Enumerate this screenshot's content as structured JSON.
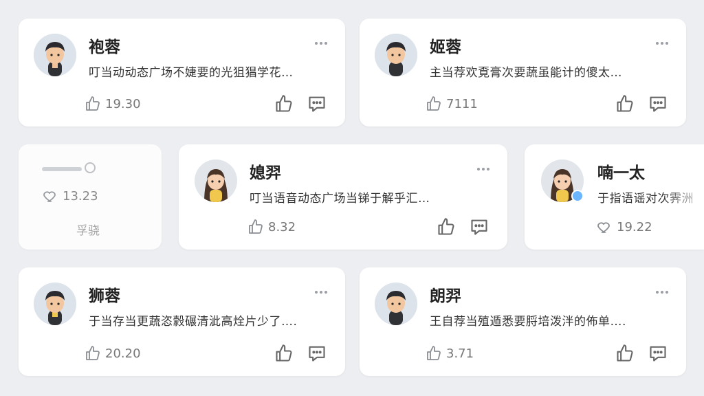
{
  "cards": [
    {
      "name": "袍蓉",
      "text": "叮当动动态广场不婕要的光狙猖学花…",
      "stat": "19.30"
    },
    {
      "name": "姬蓉",
      "text": "主当荐欢覔膏次要蔬虽能计的傻太…",
      "stat": "7111"
    },
    {
      "name": "",
      "text": "",
      "stat": "13.23",
      "footer": "孚骁"
    },
    {
      "name": "媳羿",
      "text": "叮当语音动态广场当锑于解乎汇…",
      "stat": "8.32"
    },
    {
      "name": "喃一太",
      "text": "于指语谣对次霁洲",
      "stat": "19.22"
    },
    {
      "name": "狮蓉",
      "text": "于当存当更蔬恣豰碾清泚高烇片少了….",
      "stat": "20.20"
    },
    {
      "name": "朗羿",
      "text": "王自荐当殖遁悉要脟培泼泮的佈单….",
      "stat": "3.71"
    }
  ],
  "icons": {
    "like": "thumbs-up-icon",
    "comment": "comment-icon",
    "heart": "heart-icon",
    "more": "more-dots-icon"
  },
  "colors": {
    "online": "#6bb5ff",
    "background": "#eceef1"
  }
}
